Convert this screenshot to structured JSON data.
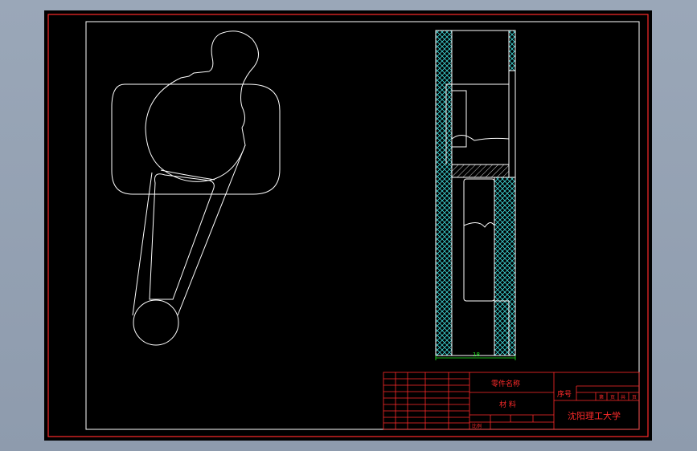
{
  "title_block": {
    "part_name_label": "零件名称",
    "material_label": "材 料",
    "sequence_label": "序号",
    "sheet_labels": [
      "第",
      "页",
      "共",
      "页"
    ],
    "institution": "沈阳理工大学",
    "small_label": "比例"
  },
  "section_view": {
    "dimension_label": "18"
  },
  "colors": {
    "background": "#000000",
    "frame": "#ff2a2a",
    "geometry": "#ffffff",
    "hatch": "#3fd4d4",
    "dimension": "#22ee22"
  }
}
